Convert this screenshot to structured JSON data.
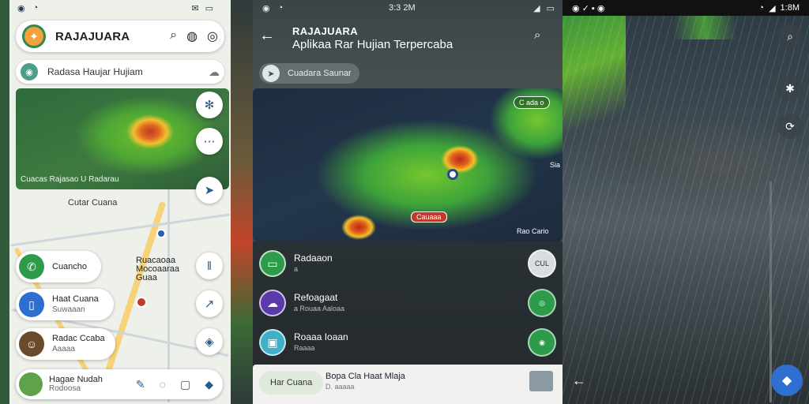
{
  "panel1": {
    "status_time": "",
    "app_name": "RAJAJUARA",
    "search_text": "Radasa Haujar Hujiam",
    "radar_caption": "Cuacas Rajasao U Radarau",
    "city_label": "Cutar Cuana",
    "location_label_1": "Ruacaoaa",
    "location_label_2": "Mocoaaraa",
    "location_label_3": "Guaa",
    "cards": [
      {
        "title": "Cuancho",
        "sub": "",
        "color": "#2e9b4a"
      },
      {
        "title": "Haat Cuana",
        "sub": "Suwaaan",
        "color": "#2c6fd0"
      },
      {
        "title": "Radac Ccaba",
        "sub": "Aaaaa",
        "color": "#6b4a2b"
      },
      {
        "title": "Hagae Nudah",
        "sub": "Rodoosa",
        "color": "#5ea24a"
      }
    ]
  },
  "panel2": {
    "status_time": "3:3 2M",
    "title_line1": "RAJAJUARA",
    "title_line2": "Aplikaa Rar Hujian Terpercaba",
    "chip_label": "Cuadara Saunar",
    "radar_tag": "C ada o",
    "radar_label_bottom": "Rao Cario",
    "radar_label_side": "Sia",
    "radar_redtag": "Cauaaa",
    "rows": [
      {
        "title": "Radaaon",
        "sub": "a",
        "icon_color": "#2e9b4a",
        "btn_color": "#d9dde0",
        "btn_text": "CUL"
      },
      {
        "title": "Refoagaat",
        "sub": "a Rouaa Aaloaa",
        "icon_color": "#5a3aa8",
        "btn_color": "#2e9b4a",
        "btn_text": ""
      },
      {
        "title": "Roaaa Ioaan",
        "sub": "Raaaa",
        "icon_color": "#3fb0c8",
        "btn_color": "#2e9b4a",
        "btn_text": ""
      }
    ],
    "bottom_chip": "Har Cuana",
    "bottom_title": "Bopa Cla Haat Mlaja",
    "bottom_sub": "D. aaaaa"
  },
  "panel3": {
    "status_time": "",
    "status_right": "1:8M"
  }
}
